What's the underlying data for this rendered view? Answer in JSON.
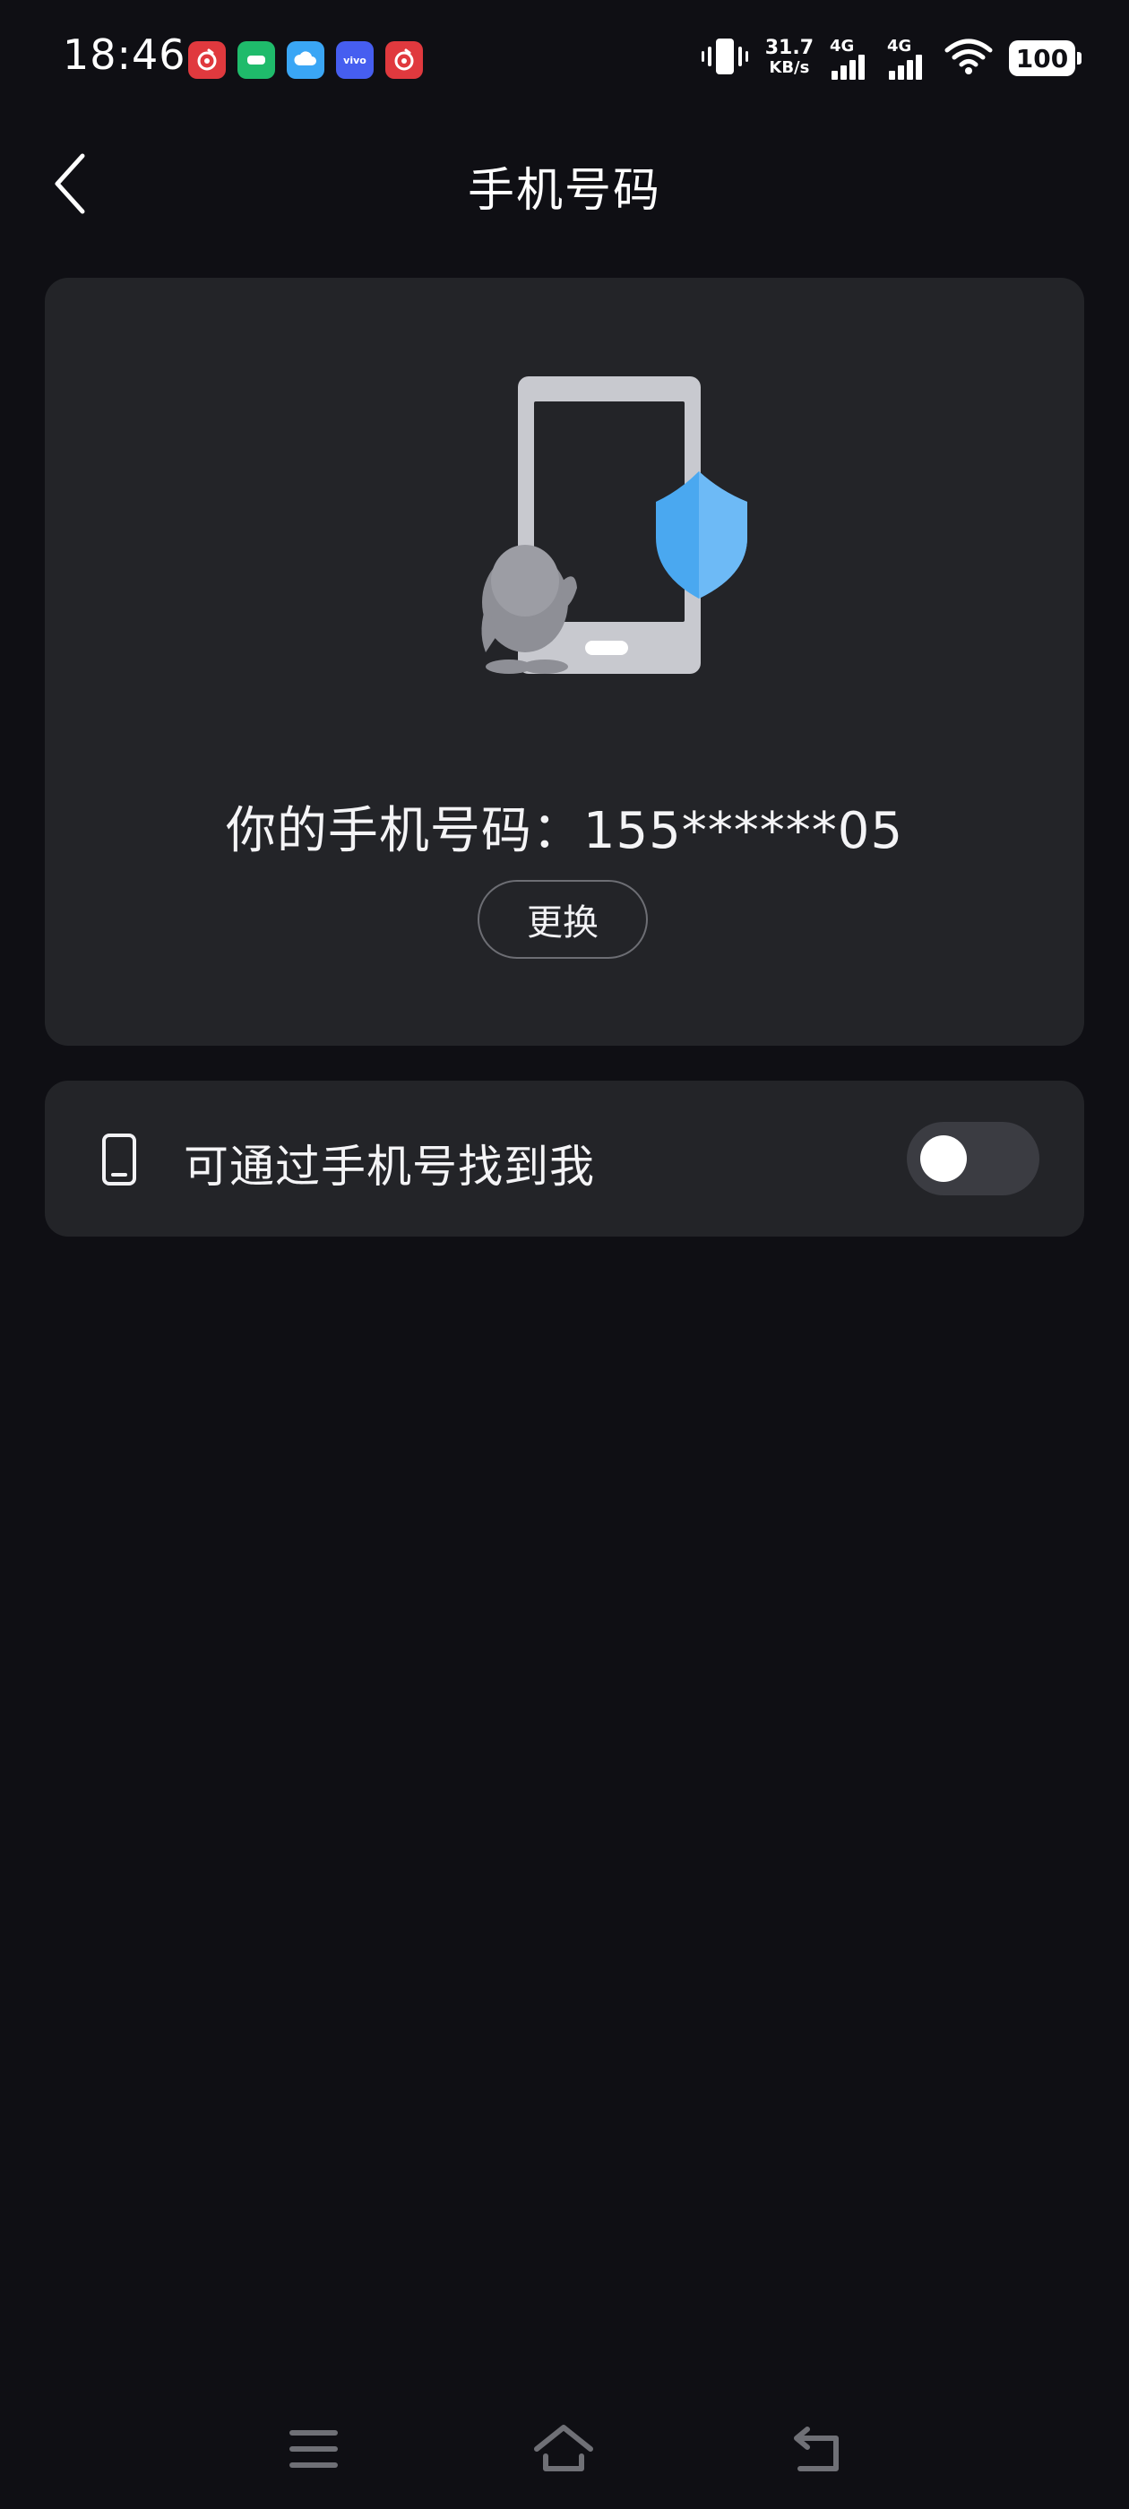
{
  "status_bar": {
    "time": "18:46",
    "notifications": [
      {
        "icon": "netease-music-icon",
        "text": ""
      },
      {
        "icon": "wechat-icon",
        "text": ""
      },
      {
        "icon": "cloud-icon",
        "text": ""
      },
      {
        "icon": "vivo-icon",
        "text": "vivo"
      },
      {
        "icon": "netease-music-icon",
        "text": ""
      }
    ],
    "net_speed_value": "31.7",
    "net_speed_unit": "KB/s",
    "signal_1_label": "4G",
    "signal_2_label": "4G",
    "battery": "100"
  },
  "header": {
    "title": "手机号码"
  },
  "phone_card": {
    "number_text": "你的手机号码：155******05",
    "change_label": "更换"
  },
  "find_card": {
    "label": "可通过手机号找到我",
    "toggle_on": false
  },
  "colors": {
    "background": "#0f0f14",
    "card": "#232428",
    "shield_blue": "#4aa8f0",
    "toggle_off": "#3b3c42"
  },
  "nav_bar": {
    "items": [
      "menu-icon",
      "home-icon",
      "back-icon"
    ]
  }
}
